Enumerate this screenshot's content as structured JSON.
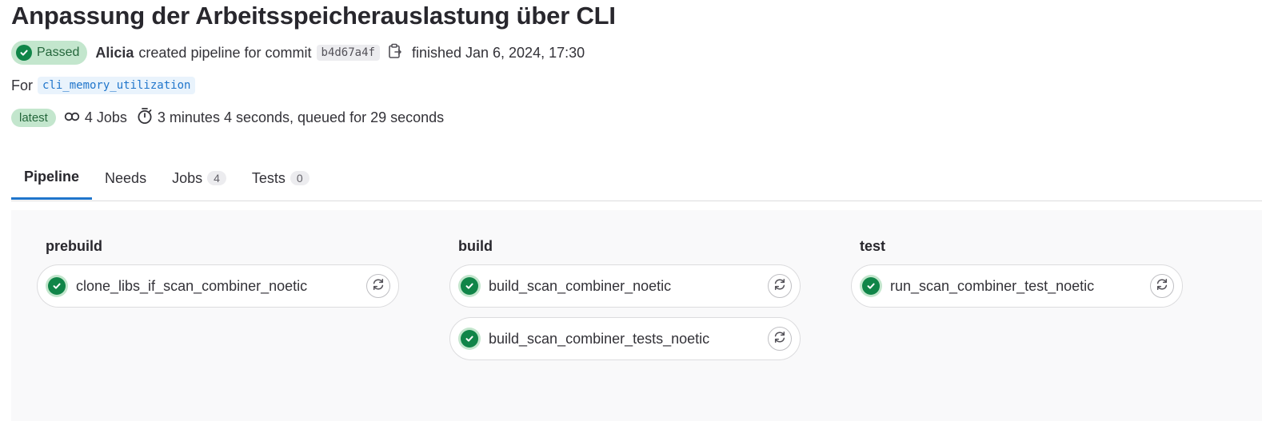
{
  "pipeline": {
    "title": "Anpassung der Arbeitsspeicherauslastung über CLI",
    "status": "Passed",
    "author": "Alicia",
    "created_text": "created pipeline for commit",
    "commit_sha": "b4d67a4f",
    "finished_text": "finished Jan 6, 2024, 17:30",
    "ref_prefix": "For",
    "branch": "cli_memory_utilization",
    "latest_label": "latest",
    "jobs_summary": "4 Jobs",
    "duration": "3 minutes 4 seconds, queued for 29 seconds"
  },
  "tabs": [
    {
      "label": "Pipeline",
      "count": null,
      "active": true
    },
    {
      "label": "Needs",
      "count": null,
      "active": false
    },
    {
      "label": "Jobs",
      "count": "4",
      "active": false
    },
    {
      "label": "Tests",
      "count": "0",
      "active": false
    }
  ],
  "stages": [
    {
      "name": "prebuild",
      "jobs": [
        {
          "name": "clone_libs_if_scan_combiner_noetic",
          "status": "passed"
        }
      ]
    },
    {
      "name": "build",
      "jobs": [
        {
          "name": "build_scan_combiner_noetic",
          "status": "passed"
        },
        {
          "name": "build_scan_combiner_tests_noetic",
          "status": "passed"
        }
      ]
    },
    {
      "name": "test",
      "jobs": [
        {
          "name": "run_scan_combiner_test_noetic",
          "status": "passed"
        }
      ]
    }
  ],
  "icons": {
    "status": "check-circle-icon",
    "copy": "clipboard-icon",
    "jobs": "link-icon",
    "duration": "timer-icon",
    "retry": "retry-icon"
  },
  "colors": {
    "success": "#108548",
    "success_bg": "#c3e6cd",
    "link": "#1f75cb",
    "canvas_bg": "#f9f9fa"
  }
}
